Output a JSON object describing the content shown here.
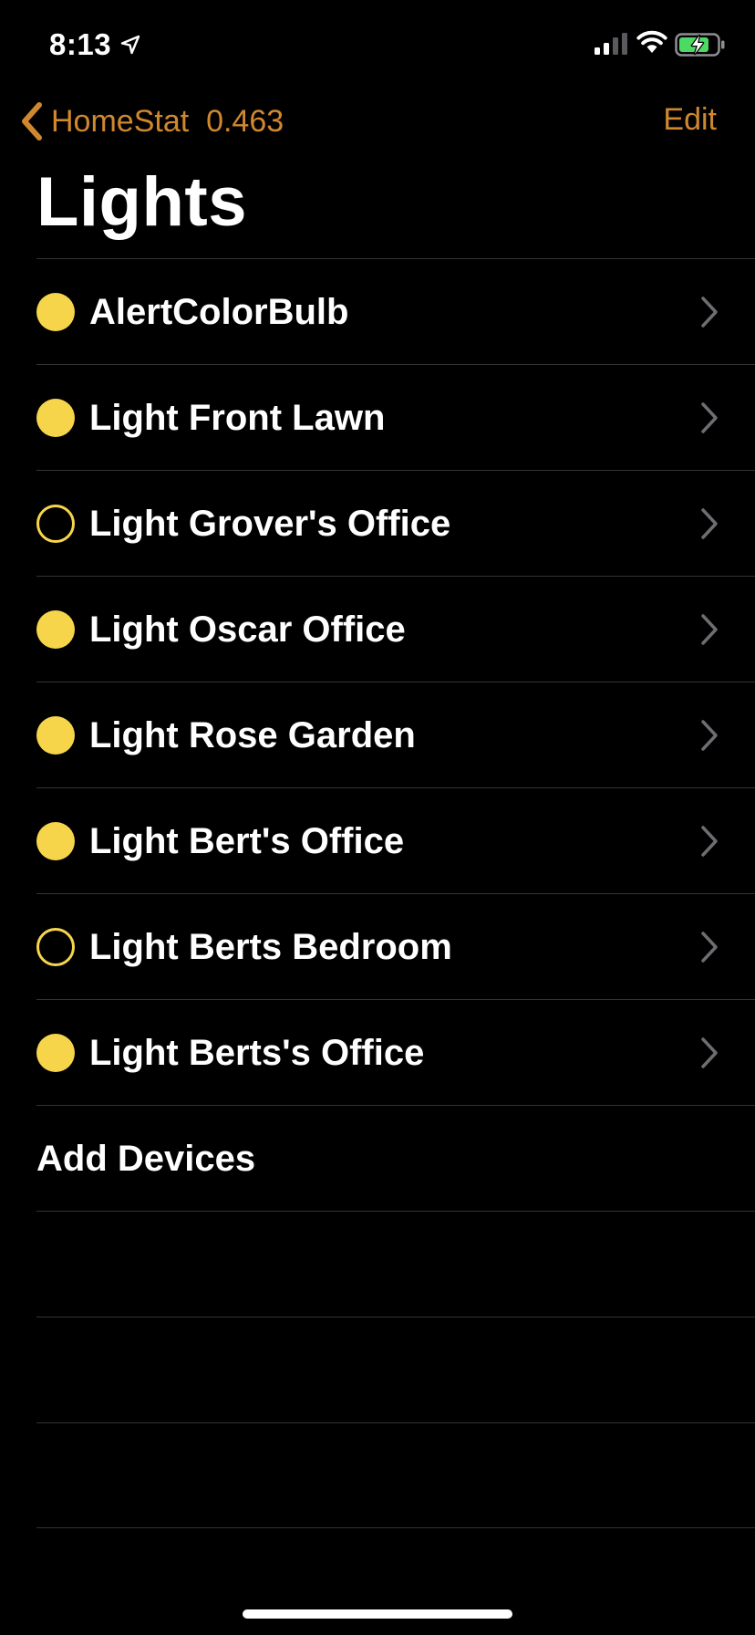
{
  "status_bar": {
    "time": "8:13",
    "icons": [
      "location-arrow-icon",
      "cellular-signal-icon",
      "wifi-icon",
      "battery-charging-icon"
    ]
  },
  "nav": {
    "back_label": "HomeStat  0.463",
    "edit_label": "Edit"
  },
  "title": "Lights",
  "devices": [
    {
      "name": "AlertColorBulb",
      "on": true
    },
    {
      "name": "Light Front Lawn",
      "on": true
    },
    {
      "name": "Light Grover's Office",
      "on": false
    },
    {
      "name": "Light Oscar Office",
      "on": true
    },
    {
      "name": "Light Rose Garden",
      "on": true
    },
    {
      "name": "Light Bert's Office",
      "on": true
    },
    {
      "name": "Light Berts Bedroom",
      "on": false
    },
    {
      "name": "Light Berts's Office",
      "on": true
    }
  ],
  "add_devices_label": "Add Devices",
  "colors": {
    "accent": "#d0882e",
    "status_on": "#f7d54b",
    "background": "#000000",
    "separator": "#333336"
  }
}
